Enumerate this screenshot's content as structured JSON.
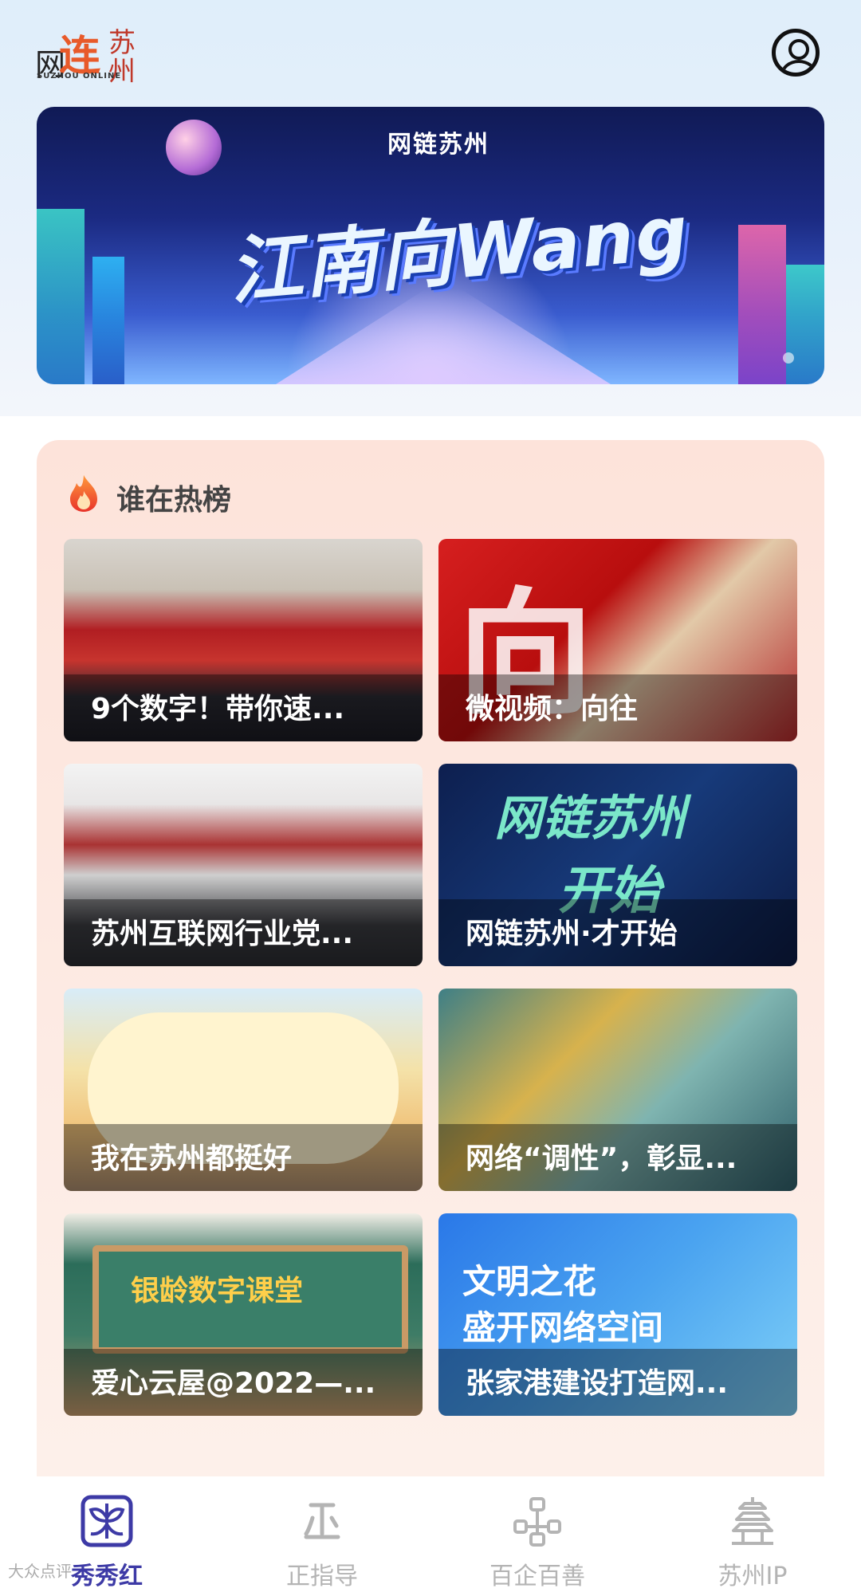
{
  "header": {
    "logo": {
      "wang": "网",
      "lian": "连",
      "suzhou": "苏州",
      "en": "SUZHOU ONLINE"
    },
    "profile_icon": "user-circle-icon"
  },
  "banner": {
    "logo_text": "网链苏州",
    "title": "江南向Wang"
  },
  "hot_list": {
    "title": "谁在热榜",
    "icon": "fire-icon",
    "items": [
      {
        "caption": "9个数字！带你速..."
      },
      {
        "caption": "微视频：向往",
        "art_text": "向"
      },
      {
        "caption": "苏州互联网行业党..."
      },
      {
        "caption": "网链苏州·才开始",
        "art_text_1": "网链苏州",
        "art_text_2": "开始"
      },
      {
        "caption": "我在苏州都挺好"
      },
      {
        "caption": "网络“调性”，彰显..."
      },
      {
        "caption": "爱心云屋@2022—...",
        "art_text": "银龄数字课堂"
      },
      {
        "caption": "张家港建设打造网...",
        "art_text_1": "文明之花",
        "art_text_2": "盛开网络空间"
      }
    ]
  },
  "bottom_nav": {
    "items": [
      {
        "label": "秀秀红",
        "icon": "butterfly-icon",
        "active": true
      },
      {
        "label": "正指导",
        "icon": "guide-icon",
        "active": false
      },
      {
        "label": "百企百善",
        "icon": "network-icon",
        "active": false
      },
      {
        "label": "苏州IP",
        "icon": "pagoda-icon",
        "active": false
      }
    ],
    "active_color": "#3d3aa6",
    "inactive_color": "#b4b4b4"
  },
  "watermark": "大众点评"
}
